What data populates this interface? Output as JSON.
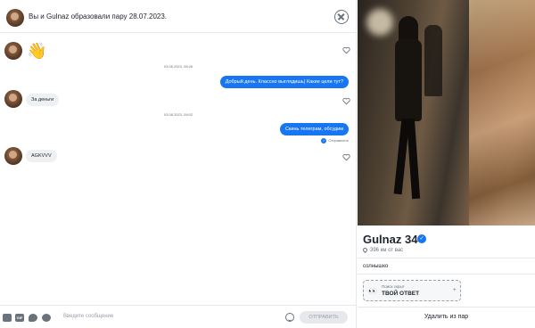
{
  "header": {
    "title": "Вы и Gulnaz образовали пару 28.07.2023."
  },
  "messages": {
    "wave_emoji": "👋",
    "stamp1": "03.08.2023, 08:26",
    "out1": "Добрый день. Классно выглядишь) Какие цели тут?",
    "in1": "За деньги",
    "stamp2": "03.08.2023, 09:02",
    "out2": "Скинь телеграм, обсудим",
    "status": "Отправлено",
    "in2": "AGKVVV"
  },
  "composer": {
    "gif_label": "GIF",
    "placeholder": "Введите сообщение",
    "send_label": "ОТПРАВИТЬ"
  },
  "profile": {
    "name": "Gulnaz",
    "age": "34",
    "distance": "396 км от вас",
    "bio": "солнышко",
    "search_label": "Поиск скрыт",
    "search_value": "ТВОЙ ОТВЕТ",
    "remove_label": "Удалить из пар"
  },
  "colors": {
    "accent": "#1976f2",
    "bubble_in": "#eef0f2",
    "text": "#21262e",
    "muted": "#6a727c"
  },
  "icons": [
    "close-icon",
    "heart-icon",
    "photo-icon",
    "gif-icon",
    "sticker-icon",
    "hashtag-icon",
    "emoji-icon",
    "location-pin-icon",
    "verified-icon"
  ]
}
